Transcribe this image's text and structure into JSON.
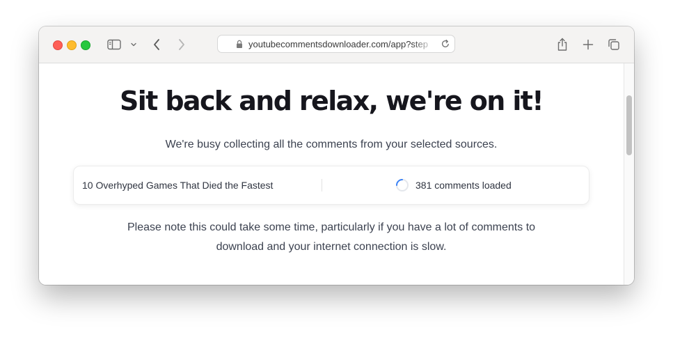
{
  "browser": {
    "url": "youtubecommentsdownloader.com/app?step",
    "icons": {
      "close": "close-window-dot",
      "minimize": "minimize-window-dot",
      "zoom": "zoom-window-dot",
      "sidebar": "sidebar-icon",
      "chevron": "chevron-down-icon",
      "back": "back-arrow-icon",
      "forward": "forward-arrow-icon",
      "lock": "lock-icon",
      "reload": "reload-icon",
      "share": "share-icon",
      "new_tab": "plus-icon",
      "tabs_overview": "tabs-overview-icon"
    },
    "colors": {
      "close": "#fe5f57",
      "minimize": "#febc2e",
      "zoom": "#28c840"
    }
  },
  "page": {
    "headline": "Sit back and relax, we're on it!",
    "subline": "We're busy collecting all the comments from your selected sources.",
    "source": {
      "title": "10 Overhyped Games That Died the Fastest",
      "status": "381 comments loaded"
    },
    "note": "Please note this could take some time, particularly if you have a lot of comments to download and your internet connection is slow.",
    "accent_color": "#3b82f6"
  }
}
